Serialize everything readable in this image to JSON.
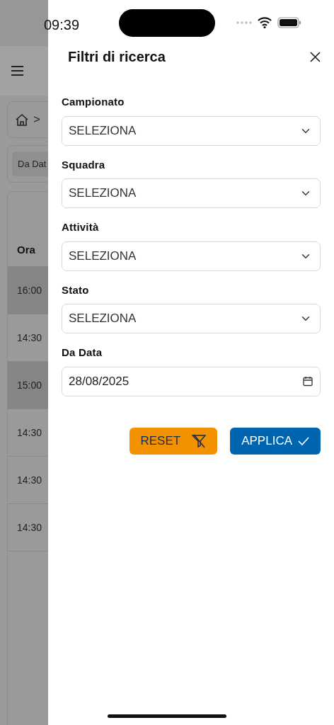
{
  "status_bar": {
    "time": "09:39"
  },
  "background_page": {
    "breadcrumb": {
      "separator": ">"
    },
    "filter_chip": "Da Dat",
    "table": {
      "columns": [
        "Ora"
      ],
      "rows": [
        {
          "time": "16:00",
          "highlighted": true
        },
        {
          "time": "14:30",
          "highlighted": false
        },
        {
          "time": "15:00",
          "highlighted": true
        },
        {
          "time": "14:30",
          "highlighted": false
        },
        {
          "time": "14:30",
          "highlighted": false
        },
        {
          "time": "14:30",
          "highlighted": false
        }
      ]
    }
  },
  "filter_panel": {
    "title": "Filtri di ricerca",
    "fields": [
      {
        "kind": "select",
        "label": "Campionato",
        "value": "SELEZIONA"
      },
      {
        "kind": "select",
        "label": "Squadra",
        "value": "SELEZIONA"
      },
      {
        "kind": "select",
        "label": "Attività",
        "value": "SELEZIONA"
      },
      {
        "kind": "select",
        "label": "Stato",
        "value": "SELEZIONA"
      },
      {
        "kind": "date",
        "label": "Da Data",
        "value": "28/08/2025"
      }
    ],
    "buttons": [
      {
        "kind": "reset",
        "label": "RESET"
      },
      {
        "kind": "apply",
        "label": "APPLICA"
      }
    ]
  }
}
